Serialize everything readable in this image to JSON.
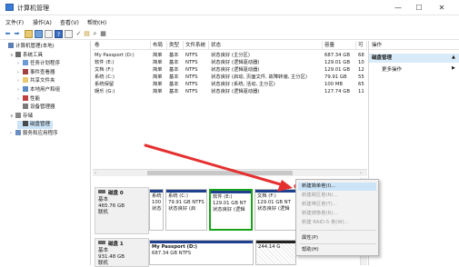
{
  "window": {
    "title": "计算机管理",
    "controls": [
      "—",
      "☐",
      "✕"
    ]
  },
  "menubar": [
    "文件(F)",
    "操作(A)",
    "查看(V)",
    "帮助(H)"
  ],
  "tree": [
    {
      "label": "计算机管理(本地)",
      "indent": 0,
      "expander": "",
      "icon": "computer"
    },
    {
      "label": "系统工具",
      "indent": 1,
      "expander": "∨",
      "icon": "tools"
    },
    {
      "label": "任务计划程序",
      "indent": 2,
      "expander": "›",
      "icon": "clock"
    },
    {
      "label": "事件查看器",
      "indent": 2,
      "expander": "›",
      "icon": "event"
    },
    {
      "label": "共享文件夹",
      "indent": 2,
      "expander": "›",
      "icon": "folder"
    },
    {
      "label": "本地用户和组",
      "indent": 2,
      "expander": "›",
      "icon": "users"
    },
    {
      "label": "性能",
      "indent": 2,
      "expander": "›",
      "icon": "perf"
    },
    {
      "label": "设备管理器",
      "indent": 2,
      "expander": "",
      "icon": "device"
    },
    {
      "label": "存储",
      "indent": 1,
      "expander": "∨",
      "icon": "storage"
    },
    {
      "label": "磁盘管理",
      "indent": 2,
      "expander": "",
      "icon": "disk"
    },
    {
      "label": "服务和应用程序",
      "indent": 1,
      "expander": "›",
      "icon": "services"
    }
  ],
  "volume_table": {
    "headers": [
      "卷",
      "布局",
      "类型",
      "文件系统",
      "状态",
      "容量",
      "可"
    ],
    "rows": [
      [
        "My Passport (D:)",
        "简单",
        "基本",
        "NTFS",
        "状态良好 (主分区)",
        "687.34 GB",
        "68"
      ],
      [
        "软件 (E:)",
        "简单",
        "基本",
        "NTFS",
        "状态良好 (逻辑驱动器)",
        "129.01 GB",
        "10"
      ],
      [
        "文档 (F:)",
        "简单",
        "基本",
        "NTFS",
        "状态良好 (逻辑驱动器)",
        "129.01 GB",
        "12"
      ],
      [
        "系统 (C:)",
        "简单",
        "基本",
        "NTFS",
        "状态良好 (启动, 页面文件, 故障转储, 主分区)",
        "79.91 GB",
        "55"
      ],
      [
        "系统保留",
        "简单",
        "基本",
        "NTFS",
        "状态良好 (系统, 活动, 主分区)",
        "100 MB",
        "65"
      ],
      [
        "娱乐 (G:)",
        "简单",
        "基本",
        "NTFS",
        "状态良好 (逻辑驱动器)",
        "127.74 GB",
        "11"
      ]
    ]
  },
  "actions": {
    "header": "操作",
    "section": "磁盘管理",
    "more": "更多操作"
  },
  "disk0": {
    "name": "磁盘 0",
    "type": "基本",
    "size": "465.76 GB",
    "state": "联机",
    "partitions": [
      {
        "l1": "系统",
        "l2": "100",
        "l3": "状态"
      },
      {
        "l1": "系统 (C:)",
        "l2": "79.91 GB NTFS",
        "l3": "状态良好 (启"
      },
      {
        "l1": "软件 (E:)",
        "l2": "129.01 GB NT",
        "l3": "状态良好 (逻辑"
      },
      {
        "l1": "文档 (F:)",
        "l2": "129.01 GB NT",
        "l3": "状态良好 (逻辑"
      }
    ]
  },
  "disk1": {
    "name": "磁盘 1",
    "type": "基本",
    "size": "931.48 GB",
    "state": "联机",
    "partitions": [
      {
        "l1": "My Passport (D:)",
        "l2": "687.34 GB NTFS",
        "l3": ""
      },
      {
        "l1": "",
        "l2": "244.14 G",
        "l3": ""
      }
    ]
  },
  "context_menu": [
    {
      "label": "新建简单卷(I)...",
      "state": "highlighted"
    },
    {
      "label": "新建跨区卷(N)...",
      "state": "disabled"
    },
    {
      "label": "新建带区卷(T)...",
      "state": "disabled"
    },
    {
      "label": "新建镜像卷(R)...",
      "state": "disabled"
    },
    {
      "label": "新建 RAID-5 卷(W)...",
      "state": "disabled"
    },
    {
      "label": "属性(P)",
      "state": "normal"
    },
    {
      "label": "帮助(H)",
      "state": "normal"
    }
  ],
  "colors": {
    "accent": "#d9ebf9",
    "partition_bar": "#1f3f8f",
    "selected_border": "#1aa31a",
    "annotation": "#e53030"
  }
}
